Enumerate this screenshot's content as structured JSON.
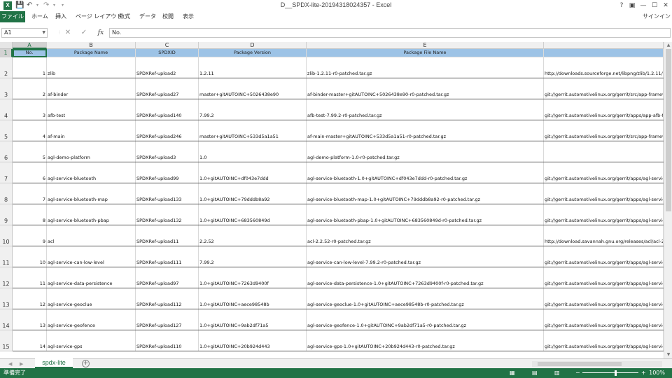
{
  "window": {
    "title": "D__SPDX-lite-20194318024357 - Excel",
    "signin": "サインイン",
    "help": "?",
    "restore": "▣",
    "minimize": "—",
    "maximize": "☐",
    "close": "✕"
  },
  "ribbon": {
    "tabs": [
      "ファイル",
      "ホーム",
      "挿入",
      "ページ レイアウト",
      "数式",
      "データ",
      "校閲",
      "表示"
    ]
  },
  "formula_bar": {
    "name_box": "A1",
    "content": "No."
  },
  "columns": [
    "A",
    "B",
    "C",
    "D",
    "E",
    ""
  ],
  "headers": [
    "No.",
    "Package Name",
    "SPDXID",
    "Package Version",
    "Package File Name",
    ""
  ],
  "rows": [
    {
      "row": "1"
    },
    {
      "row": "2",
      "no": "1",
      "name": "zlib",
      "spdxid": "SPDXRef-upload2",
      "version": "1.2.11",
      "file": "zlib-1.2.11-r0-patched.tar.gz",
      "url": "http://downloads.sourceforge.net/libpng/zlib/1.2.11/z"
    },
    {
      "row": "3",
      "no": "2",
      "name": "af-binder",
      "spdxid": "SPDXRef-upload27",
      "version": "master+gitAUTOINC+5026438e90",
      "file": "af-binder-master+gitAUTOINC+5026438e90-r0-patched.tar.gz",
      "url": "git://gerrit.automotivelinux.org/gerrit/src/app-framev"
    },
    {
      "row": "4",
      "no": "3",
      "name": "afb-test",
      "spdxid": "SPDXRef-upload140",
      "version": "7.99.2",
      "file": "afb-test-7.99.2-r0-patched.tar.gz",
      "url": "git://gerrit.automotivelinux.org/gerrit/apps/app-afb-t"
    },
    {
      "row": "5",
      "no": "4",
      "name": "af-main",
      "spdxid": "SPDXRef-upload246",
      "version": "master+gitAUTOINC+533d5a1a51",
      "file": "af-main-master+gitAUTOINC+533d5a1a51-r0-patched.tar.gz",
      "url": "git://gerrit.automotivelinux.org/gerrit/src/app-framev"
    },
    {
      "row": "6",
      "no": "5",
      "name": "agl-demo-platform",
      "spdxid": "SPDXRef-upload3",
      "version": "1.0",
      "file": "agl-demo-platform-1.0-r0-patched.tar.gz",
      "url": ""
    },
    {
      "row": "7",
      "no": "6",
      "name": "agl-service-bluetooth",
      "spdxid": "SPDXRef-upload99",
      "version": "1.0+gitAUTOINC+df043e7ddd",
      "file": "agl-service-bluetooth-1.0+gitAUTOINC+df043e7ddd-r0-patched.tar.gz",
      "url": "git://gerrit.automotivelinux.org/gerrit/apps/agl-servic"
    },
    {
      "row": "8",
      "no": "7",
      "name": "agl-service-bluetooth-map",
      "spdxid": "SPDXRef-upload133",
      "version": "1.0+gitAUTOINC+79dddb8a92",
      "file": "agl-service-bluetooth-map-1.0+gitAUTOINC+79dddb8a92-r0-patched.tar.gz",
      "url": "git://gerrit.automotivelinux.org/gerrit/apps/agl-servic"
    },
    {
      "row": "9",
      "no": "8",
      "name": "agl-service-bluetooth-pbap",
      "spdxid": "SPDXRef-upload132",
      "version": "1.0+gitAUTOINC+683560849d",
      "file": "agl-service-bluetooth-pbap-1.0+gitAUTOINC+683560849d-r0-patched.tar.gz",
      "url": "git://gerrit.automotivelinux.org/gerrit/apps/agl-servic"
    },
    {
      "row": "10",
      "no": "9",
      "name": "acl",
      "spdxid": "SPDXRef-upload11",
      "version": "2.2.52",
      "file": "acl-2.2.52-r0-patched.tar.gz",
      "url": "http://download.savannah.gnu.org/releases/acl/acl-2."
    },
    {
      "row": "11",
      "no": "10",
      "name": "agl-service-can-low-level",
      "spdxid": "SPDXRef-upload111",
      "version": "7.99.2",
      "file": "agl-service-can-low-level-7.99.2-r0-patched.tar.gz",
      "url": "git://gerrit.automotivelinux.org/gerrit/apps/agl-servic"
    },
    {
      "row": "12",
      "no": "11",
      "name": "agl-service-data-persistence",
      "spdxid": "SPDXRef-upload97",
      "version": "1.0+gitAUTOINC+7263d9400f",
      "file": "agl-service-data-persistence-1.0+gitAUTOINC+7263d9400f-r0-patched.tar.gz",
      "url": "git://gerrit.automotivelinux.org/gerrit/apps/agl-servic"
    },
    {
      "row": "13",
      "no": "12",
      "name": "agl-service-geoclue",
      "spdxid": "SPDXRef-upload112",
      "version": "1.0+gitAUTOINC+aece98548b",
      "file": "agl-service-geoclue-1.0+gitAUTOINC+aece98548b-r0-patched.tar.gz",
      "url": "git://gerrit.automotivelinux.org/gerrit/apps/agl-servic"
    },
    {
      "row": "14",
      "no": "13",
      "name": "agl-service-geofence",
      "spdxid": "SPDXRef-upload127",
      "version": "1.0+gitAUTOINC+9ab2df71a5",
      "file": "agl-service-geofence-1.0+gitAUTOINC+9ab2df71a5-r0-patched.tar.gz",
      "url": "git://gerrit.automotivelinux.org/gerrit/apps/agl-servic"
    },
    {
      "row": "15",
      "no": "14",
      "name": "agl-service-gps",
      "spdxid": "SPDXRef-upload110",
      "version": "1.0+gitAUTOINC+20b924d443",
      "file": "agl-service-gps-1.0+gitAUTOINC+20b924d443-r0-patched.tar.gz",
      "url": "git://gerrit.automotivelinux.org/gerrit/apps/agl-servic"
    }
  ],
  "sheet": {
    "tab": "spdx-lite",
    "add": "+"
  },
  "status": {
    "ready": "準備完了",
    "zoom": "100%",
    "zoom_minus": "−",
    "zoom_plus": "+"
  },
  "colors": {
    "accent": "#217346",
    "header_fill": "#9dc3e6"
  },
  "icons": {
    "excel": "excel-logo-icon",
    "save": "save-icon",
    "undo": "undo-icon",
    "redo": "redo-icon",
    "cancel": "cancel-icon",
    "enter": "enter-icon",
    "fx": "function-icon",
    "add_sheet": "plus-circle-icon"
  }
}
